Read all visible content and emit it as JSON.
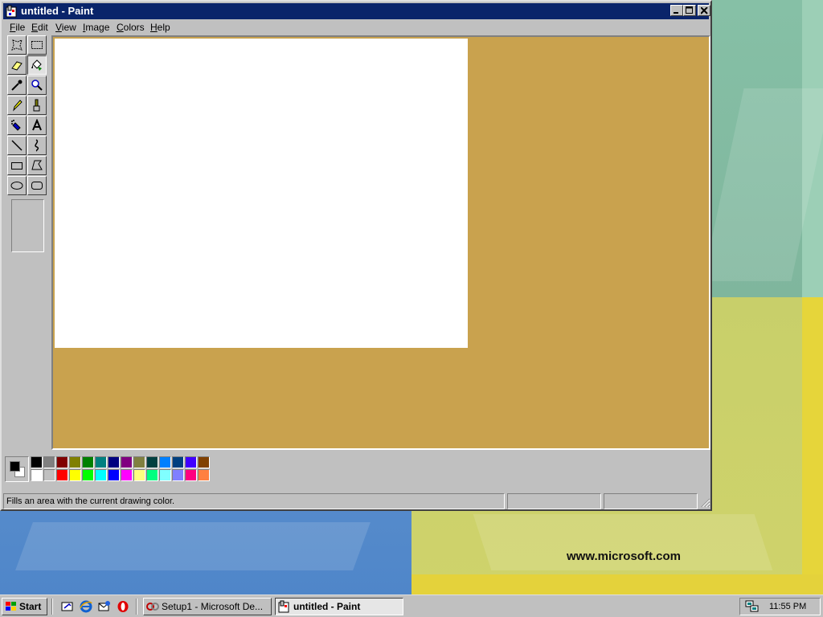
{
  "window": {
    "title": "untitled - Paint",
    "controls": {
      "minimize": "_",
      "maximize": "□",
      "close": "×"
    }
  },
  "menu": [
    {
      "label": "File",
      "access": "F"
    },
    {
      "label": "Edit",
      "access": "E"
    },
    {
      "label": "View",
      "access": "V"
    },
    {
      "label": "Image",
      "access": "I"
    },
    {
      "label": "Colors",
      "access": "C"
    },
    {
      "label": "Help",
      "access": "H"
    }
  ],
  "tools": [
    {
      "name": "free-form-select-icon"
    },
    {
      "name": "select-icon"
    },
    {
      "name": "eraser-icon"
    },
    {
      "name": "fill-with-color-icon",
      "active": true
    },
    {
      "name": "pick-color-icon"
    },
    {
      "name": "magnifier-icon"
    },
    {
      "name": "pencil-icon"
    },
    {
      "name": "brush-icon"
    },
    {
      "name": "airbrush-icon"
    },
    {
      "name": "text-icon"
    },
    {
      "name": "line-icon"
    },
    {
      "name": "curve-icon"
    },
    {
      "name": "rectangle-icon"
    },
    {
      "name": "polygon-icon"
    },
    {
      "name": "ellipse-icon"
    },
    {
      "name": "rounded-rectangle-icon"
    }
  ],
  "palette": {
    "foreground": "#000000",
    "background": "#ffffff",
    "top_row": [
      "#000000",
      "#808080",
      "#800000",
      "#808000",
      "#008000",
      "#008080",
      "#000080",
      "#800080",
      "#808040",
      "#004040",
      "#0080ff",
      "#004080",
      "#4000ff",
      "#804000"
    ],
    "bottom_row": [
      "#ffffff",
      "#c0c0c0",
      "#ff0000",
      "#ffff00",
      "#00ff00",
      "#00ffff",
      "#0000ff",
      "#ff00ff",
      "#ffff80",
      "#00ff80",
      "#80ffff",
      "#8080ff",
      "#ff0080",
      "#ff8040"
    ]
  },
  "status": {
    "text": "Fills an area with the current drawing color.",
    "position": "",
    "size": ""
  },
  "desktop": {
    "url": "www.microsoft.com"
  },
  "taskbar": {
    "start_label": "Start",
    "quick_launch": [
      "show-desktop-icon",
      "internet-explorer-icon",
      "outlook-express-icon",
      "opera-icon"
    ],
    "tasks": [
      {
        "label": "Setup1 - Microsoft De...",
        "pressed": false
      },
      {
        "label": "untitled - Paint",
        "pressed": true
      }
    ],
    "clock": "11:55 PM"
  },
  "colors": {
    "titlebar": "#0a246a",
    "workspace": "#c9a24e",
    "face": "#c0c0c0"
  }
}
